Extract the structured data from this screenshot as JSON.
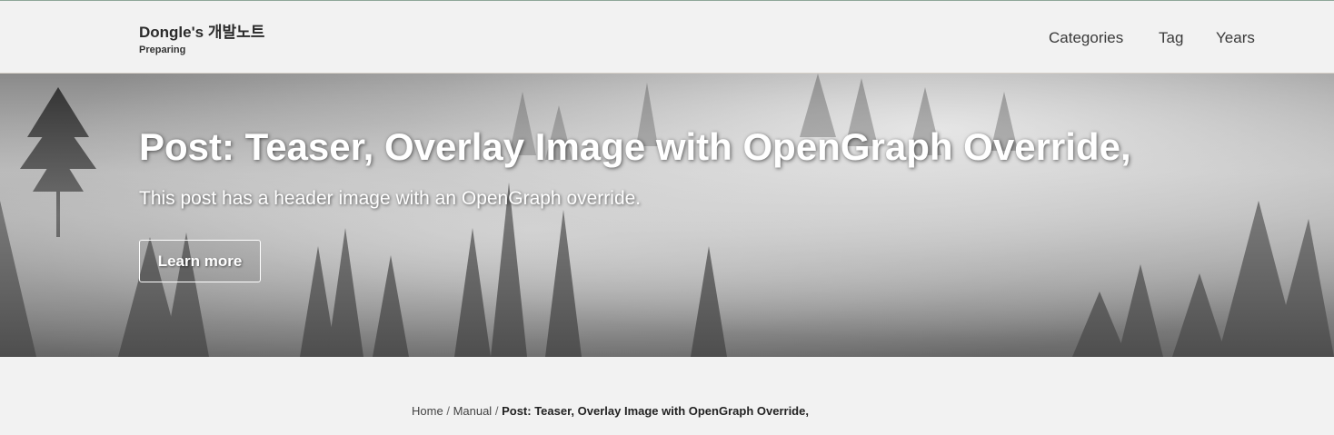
{
  "site": {
    "title": "Dongle's 개발노트",
    "subtitle": "Preparing"
  },
  "nav": {
    "items": [
      "Categories",
      "Tag",
      "Years"
    ]
  },
  "hero": {
    "title": "Post: Teaser, Overlay Image with OpenGraph Override,",
    "excerpt": "This post has a header image with an OpenGraph override.",
    "button_label": "Learn more"
  },
  "breadcrumb": {
    "items": [
      "Home",
      "Manual"
    ],
    "separator": "/",
    "current": "Post: Teaser, Overlay Image with OpenGraph Override,"
  }
}
